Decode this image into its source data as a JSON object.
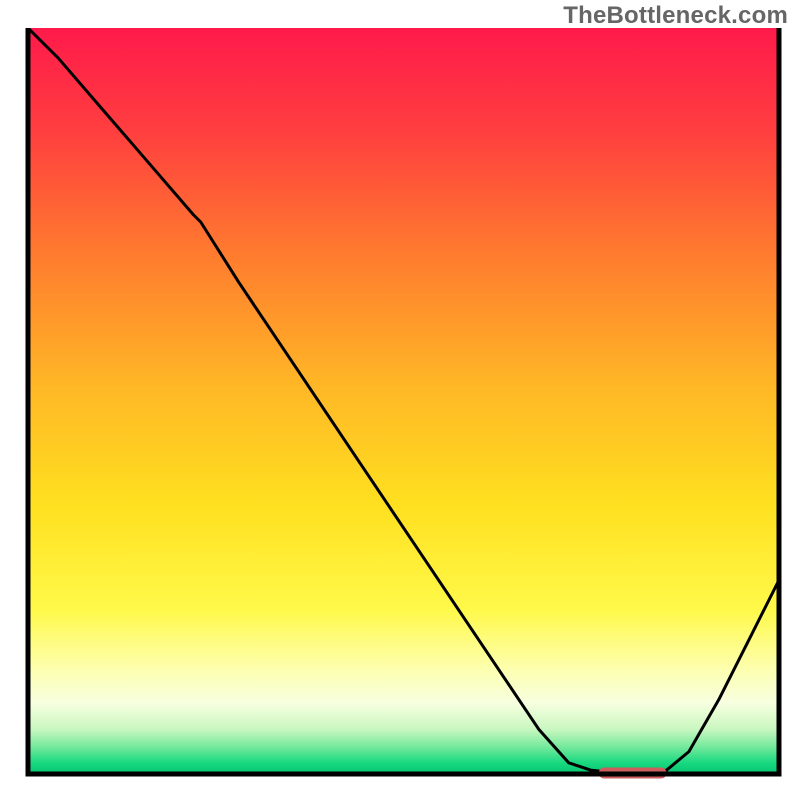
{
  "watermark": "TheBottleneck.com",
  "colors": {
    "stroke": "#000000",
    "axis": "#000000",
    "marker": "#cd5c5c",
    "gradient_stops": [
      {
        "offset": 0.0,
        "color": "#ff1a4b"
      },
      {
        "offset": 0.14,
        "color": "#ff3f3f"
      },
      {
        "offset": 0.3,
        "color": "#ff7a2f"
      },
      {
        "offset": 0.48,
        "color": "#ffb726"
      },
      {
        "offset": 0.64,
        "color": "#ffe01f"
      },
      {
        "offset": 0.78,
        "color": "#fff94a"
      },
      {
        "offset": 0.86,
        "color": "#fdffb0"
      },
      {
        "offset": 0.905,
        "color": "#f7ffe0"
      },
      {
        "offset": 0.94,
        "color": "#c9f7c0"
      },
      {
        "offset": 0.965,
        "color": "#6fe89a"
      },
      {
        "offset": 0.985,
        "color": "#18d980"
      },
      {
        "offset": 1.0,
        "color": "#05c572"
      }
    ]
  },
  "chart_data": {
    "type": "line",
    "title": "",
    "xlabel": "",
    "ylabel": "",
    "xlim": [
      0,
      100
    ],
    "ylim": [
      0,
      100
    ],
    "x": [
      0,
      4,
      10,
      16,
      22,
      23,
      28,
      36,
      44,
      52,
      60,
      68,
      72,
      75,
      78,
      82,
      85,
      88,
      92,
      96,
      100
    ],
    "y": [
      100,
      96,
      89,
      82,
      75,
      74,
      66,
      54,
      42,
      30,
      18,
      6,
      1.5,
      0.5,
      0.2,
      0.2,
      0.5,
      3,
      10,
      18,
      26
    ],
    "optimum_marker": {
      "x_start": 76,
      "x_end": 85,
      "y": 0.2
    },
    "note": "x and y are in percent of plot area; y=0 is bottom axis, y=100 is top. Curve shows bottleneck severity (high=red near top) reaching minimum (green band) around x≈76–85."
  }
}
